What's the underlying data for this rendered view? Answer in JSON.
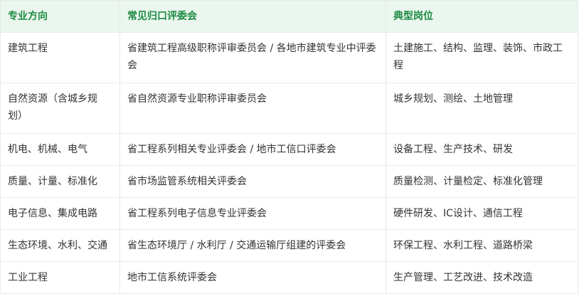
{
  "table": {
    "headers": [
      "专业方向",
      "常见归口评委会",
      "典型岗位"
    ],
    "rows": [
      [
        "建筑工程",
        "省建筑工程高级职称评审委员会 / 各地市建筑专业中评委会",
        "土建施工、结构、监理、装饰、市政工程"
      ],
      [
        "自然资源（含城乡规划）",
        "省自然资源专业职称评审委员会",
        "城乡规划、测绘、土地管理"
      ],
      [
        "机电、机械、电气",
        "省工程系列相关专业评委会 / 地市工信口评委会",
        "设备工程、生产技术、研发"
      ],
      [
        "质量、计量、标准化",
        "省市场监管系统相关评委会",
        "质量检测、计量检定、标准化管理"
      ],
      [
        "电子信息、集成电路",
        "省工程系列电子信息专业评委会",
        "硬件研发、IC设计、通信工程"
      ],
      [
        "生态环境、水利、交通",
        "省生态环境厅 / 水利厅 / 交通运输厅组建的评委会",
        "环保工程、水利工程、道路桥梁"
      ],
      [
        "工业工程",
        "地市工信系统评委会",
        "生产管理、工艺改进、技术改造"
      ]
    ]
  }
}
